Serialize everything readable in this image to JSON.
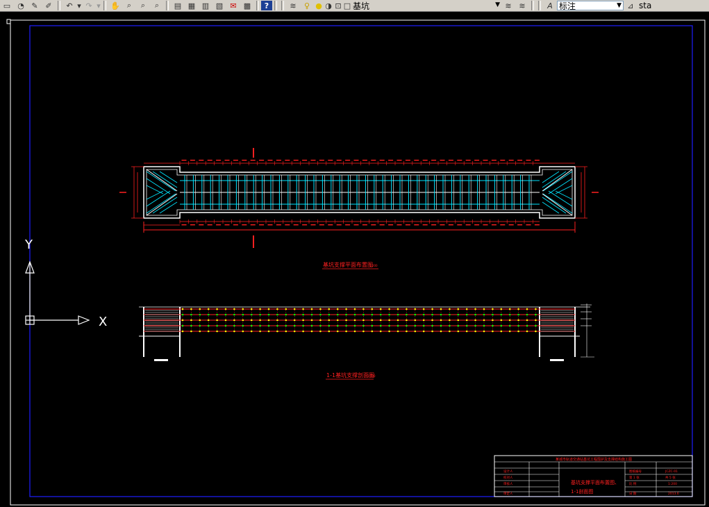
{
  "toolbar": {
    "layer_name": "基坑",
    "dim_style": "标注",
    "partial_label": "sta"
  },
  "drawing": {
    "plan_title": "基坑支撑平面布置图",
    "plan_scale": "1:200",
    "section_title": "1-1基坑支撑剖面图",
    "section_scale": "1:200",
    "section_mark": "1",
    "ucs_x": "X",
    "ucs_y": "Y"
  },
  "title_block": {
    "project": "某城市轨道交通站基坑工程围护及支撑结构施工图",
    "sheet_title_line1": "基坑支撑平面布置图、",
    "sheet_title_line2": "1-1剖面图",
    "sheet_no_label": "第 1 张",
    "sheet_total_label": "共 5 张",
    "scale_label": "比 例",
    "scale_value": "1:200",
    "date_label": "日 期",
    "date_value": "2013.6",
    "drawing_no_label": "图纸编号",
    "drawing_no_value": "JCZC-01",
    "design_label": "设计人",
    "check_label": "校对人",
    "review_label": "审核人",
    "approve_label": "审定人"
  },
  "colors": {
    "background": "#000000",
    "frame_blue": "#1e1eff",
    "red": "#ff2020",
    "cyan": "#00e5ff",
    "white": "#ffffff",
    "yellow": "#ffff00",
    "green": "#00ff00"
  }
}
